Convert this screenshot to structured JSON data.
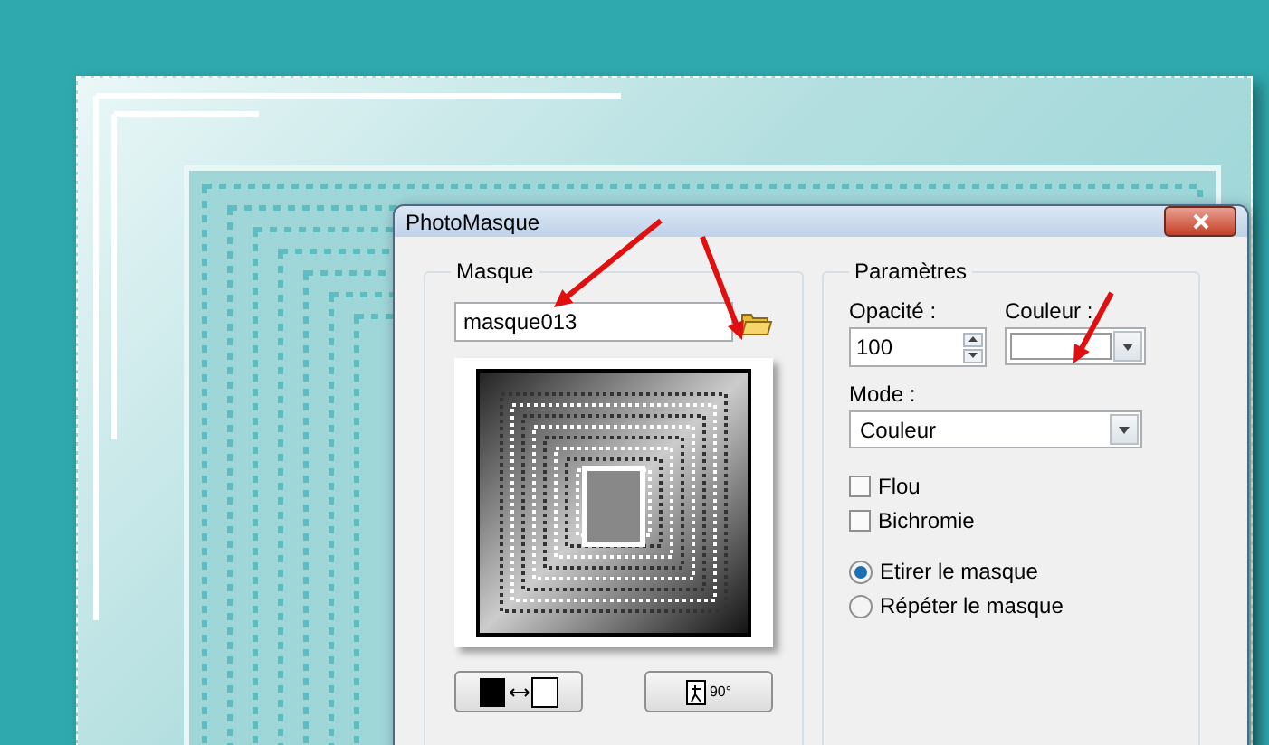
{
  "dialog": {
    "title": "PhotoMasque",
    "mask_group": {
      "label": "Masque",
      "file": "masque013",
      "rotate_label": "90°"
    },
    "params_group": {
      "label": "Paramètres",
      "opacity": {
        "label": "Opacité :",
        "value": "100"
      },
      "color": {
        "label": "Couleur :"
      },
      "mode": {
        "label": "Mode :",
        "value": "Couleur"
      },
      "checkboxes": [
        {
          "label": "Flou",
          "checked": false
        },
        {
          "label": "Bichromie",
          "checked": false
        }
      ],
      "radios": [
        {
          "label": "Etirer le masque",
          "selected": true
        },
        {
          "label": "Répéter le masque",
          "selected": false
        }
      ]
    }
  }
}
